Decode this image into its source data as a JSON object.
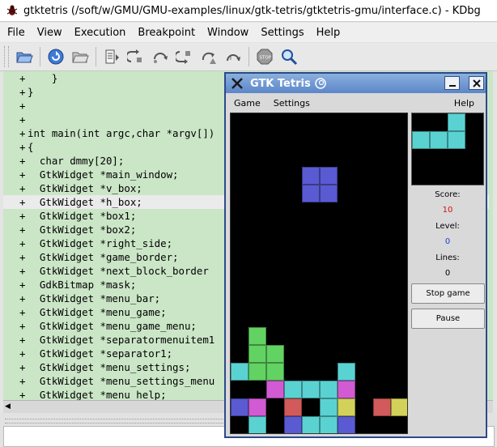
{
  "window": {
    "title": "gtktetris (/soft/w/GMU/GMU-examples/linux/gtk-tetris/gtktetris-gmu/interface.c) - KDbg"
  },
  "menubar": [
    {
      "label": "File"
    },
    {
      "label": "View"
    },
    {
      "label": "Execution"
    },
    {
      "label": "Breakpoint"
    },
    {
      "label": "Window"
    },
    {
      "label": "Settings"
    },
    {
      "label": "Help"
    }
  ],
  "toolbar": [
    {
      "icon": "open-folder-icon"
    },
    {
      "icon": "reload-icon"
    },
    {
      "icon": "open-executable-icon"
    },
    {
      "icon": "run-icon"
    },
    {
      "icon": "step-into-icon"
    },
    {
      "icon": "step-over-icon"
    },
    {
      "icon": "step-out-icon"
    },
    {
      "icon": "run-to-cursor-icon"
    },
    {
      "icon": "step-instruction-icon"
    },
    {
      "icon": "stop-icon"
    },
    {
      "icon": "find-icon"
    }
  ],
  "code": {
    "highlight_index": 9,
    "lines": [
      {
        "mark": "+",
        "text": "    }"
      },
      {
        "mark": "+",
        "text": "}"
      },
      {
        "mark": "+",
        "text": ""
      },
      {
        "mark": "+",
        "text": ""
      },
      {
        "mark": "+",
        "text": "int main(int argc,char *argv[])"
      },
      {
        "mark": "+",
        "text": "{"
      },
      {
        "mark": "+",
        "text": "  char dmmy[20];"
      },
      {
        "mark": "+",
        "text": "  GtkWidget *main_window;"
      },
      {
        "mark": "+",
        "text": "  GtkWidget *v_box;"
      },
      {
        "mark": "+",
        "text": "  GtkWidget *h_box;"
      },
      {
        "mark": "+",
        "text": "  GtkWidget *box1;"
      },
      {
        "mark": "+",
        "text": "  GtkWidget *box2;"
      },
      {
        "mark": "+",
        "text": "  GtkWidget *right_side;"
      },
      {
        "mark": "+",
        "text": "  GtkWidget *game_border;"
      },
      {
        "mark": "+",
        "text": "  GtkWidget *next_block_border"
      },
      {
        "mark": "+",
        "text": "  GdkBitmap *mask;"
      },
      {
        "mark": "+",
        "text": "  GtkWidget *menu_bar;"
      },
      {
        "mark": "+",
        "text": "  GtkWidget *menu_game;"
      },
      {
        "mark": "+",
        "text": "  GtkWidget *menu_game_menu;"
      },
      {
        "mark": "+",
        "text": "  GtkWidget *separatormenuitem1"
      },
      {
        "mark": "+",
        "text": "  GtkWidget *separator1;"
      },
      {
        "mark": "+",
        "text": "  GtkWidget *menu_settings;"
      },
      {
        "mark": "+",
        "text": "  GtkWidget *menu_settings_menu"
      },
      {
        "mark": "+",
        "text": "  GtkWidget *menu_help;"
      }
    ]
  },
  "tetris": {
    "title": "GTK Tetris",
    "menu_game": "Game",
    "menu_settings": "Settings",
    "menu_help": "Help",
    "score_label": "Score:",
    "score": "10",
    "level_label": "Level:",
    "level": "0",
    "lines_label": "Lines:",
    "lines": "0",
    "stop_button": "Stop game",
    "pause_button": "Pause",
    "colors": {
      "blue": "#5a5ad2",
      "green": "#62d262",
      "cyan": "#5ad2d2",
      "magenta": "#d25ad2",
      "red": "#d25a5a",
      "yellow": "#d2d25a"
    },
    "board_cols": 10,
    "board_cells": [
      {
        "c": 4,
        "r": 3,
        "color": "blue"
      },
      {
        "c": 5,
        "r": 3,
        "color": "blue"
      },
      {
        "c": 4,
        "r": 4,
        "color": "blue"
      },
      {
        "c": 5,
        "r": 4,
        "color": "blue"
      },
      {
        "c": 1,
        "r": 12,
        "color": "green"
      },
      {
        "c": 1,
        "r": 13,
        "color": "green"
      },
      {
        "c": 2,
        "r": 13,
        "color": "green"
      },
      {
        "c": 0,
        "r": 14,
        "color": "cyan"
      },
      {
        "c": 1,
        "r": 14,
        "color": "green"
      },
      {
        "c": 2,
        "r": 14,
        "color": "green"
      },
      {
        "c": 6,
        "r": 14,
        "color": "cyan"
      },
      {
        "c": 2,
        "r": 15,
        "color": "magenta"
      },
      {
        "c": 3,
        "r": 15,
        "color": "cyan"
      },
      {
        "c": 4,
        "r": 15,
        "color": "cyan"
      },
      {
        "c": 5,
        "r": 15,
        "color": "cyan"
      },
      {
        "c": 6,
        "r": 15,
        "color": "magenta"
      },
      {
        "c": 0,
        "r": 16,
        "color": "blue"
      },
      {
        "c": 1,
        "r": 16,
        "color": "magenta"
      },
      {
        "c": 3,
        "r": 16,
        "color": "red"
      },
      {
        "c": 5,
        "r": 16,
        "color": "cyan"
      },
      {
        "c": 6,
        "r": 16,
        "color": "yellow"
      },
      {
        "c": 8,
        "r": 16,
        "color": "red"
      },
      {
        "c": 9,
        "r": 16,
        "color": "yellow"
      },
      {
        "c": 1,
        "r": 17,
        "color": "cyan"
      },
      {
        "c": 3,
        "r": 17,
        "color": "blue"
      },
      {
        "c": 4,
        "r": 17,
        "color": "cyan"
      },
      {
        "c": 5,
        "r": 17,
        "color": "cyan"
      },
      {
        "c": 6,
        "r": 17,
        "color": "blue"
      }
    ],
    "next_cells": [
      {
        "c": 2,
        "r": 0,
        "color": "cyan"
      },
      {
        "c": 0,
        "r": 1,
        "color": "cyan"
      },
      {
        "c": 1,
        "r": 1,
        "color": "cyan"
      },
      {
        "c": 2,
        "r": 1,
        "color": "cyan"
      }
    ]
  }
}
